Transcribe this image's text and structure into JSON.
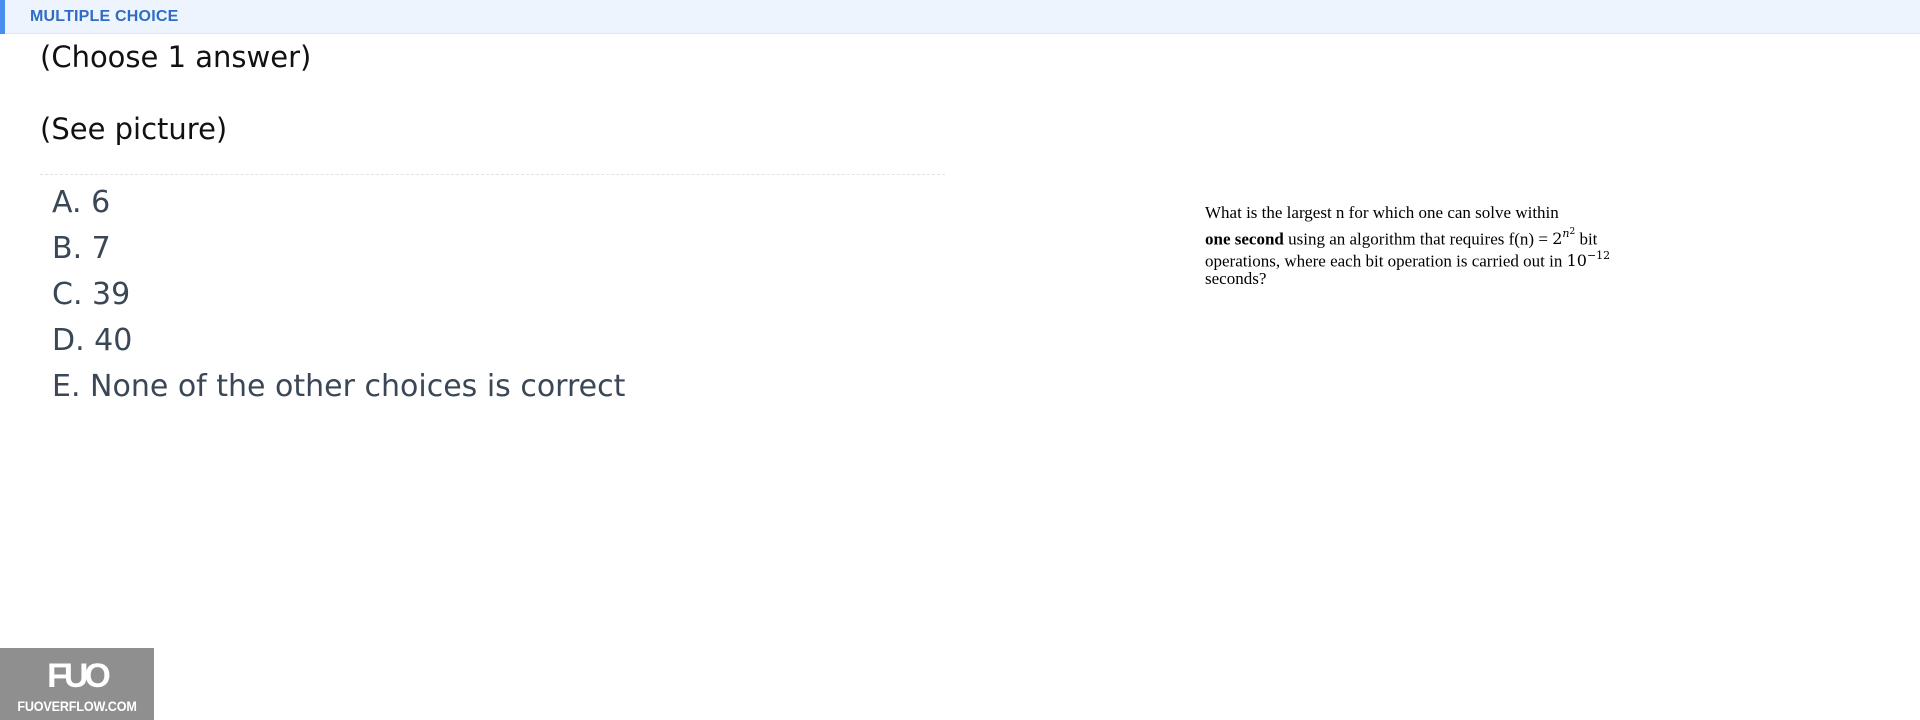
{
  "header": {
    "label": "MULTIPLE CHOICE",
    "accent_color": "#4a8cf0",
    "label_color": "#2f6cc4",
    "background": "#eef4fd"
  },
  "question": {
    "instruction": "(Choose 1 answer)",
    "picture_note": "(See picture)",
    "picture": {
      "line1": "What is the largest n for which one can solve within",
      "line2_bold": "one second",
      "line2_rest": " using an algorithm that requires f(n) = ",
      "line2_base": "2",
      "line2_exp_var": "n",
      "line2_exp_pow": "2",
      "line2_end": " bit",
      "line3_text": "operations, where each bit operation is carried out in ",
      "line3_base": "10",
      "line3_exp": "−12",
      "line4": "seconds?"
    }
  },
  "options": [
    {
      "label": "A. 6"
    },
    {
      "label": "B. 7"
    },
    {
      "label": "C. 39"
    },
    {
      "label": "D. 40"
    },
    {
      "label": "E. None of the other choices is correct"
    }
  ],
  "watermark": {
    "logo_text": "FUO",
    "site": "FUOVERFLOW.COM"
  }
}
